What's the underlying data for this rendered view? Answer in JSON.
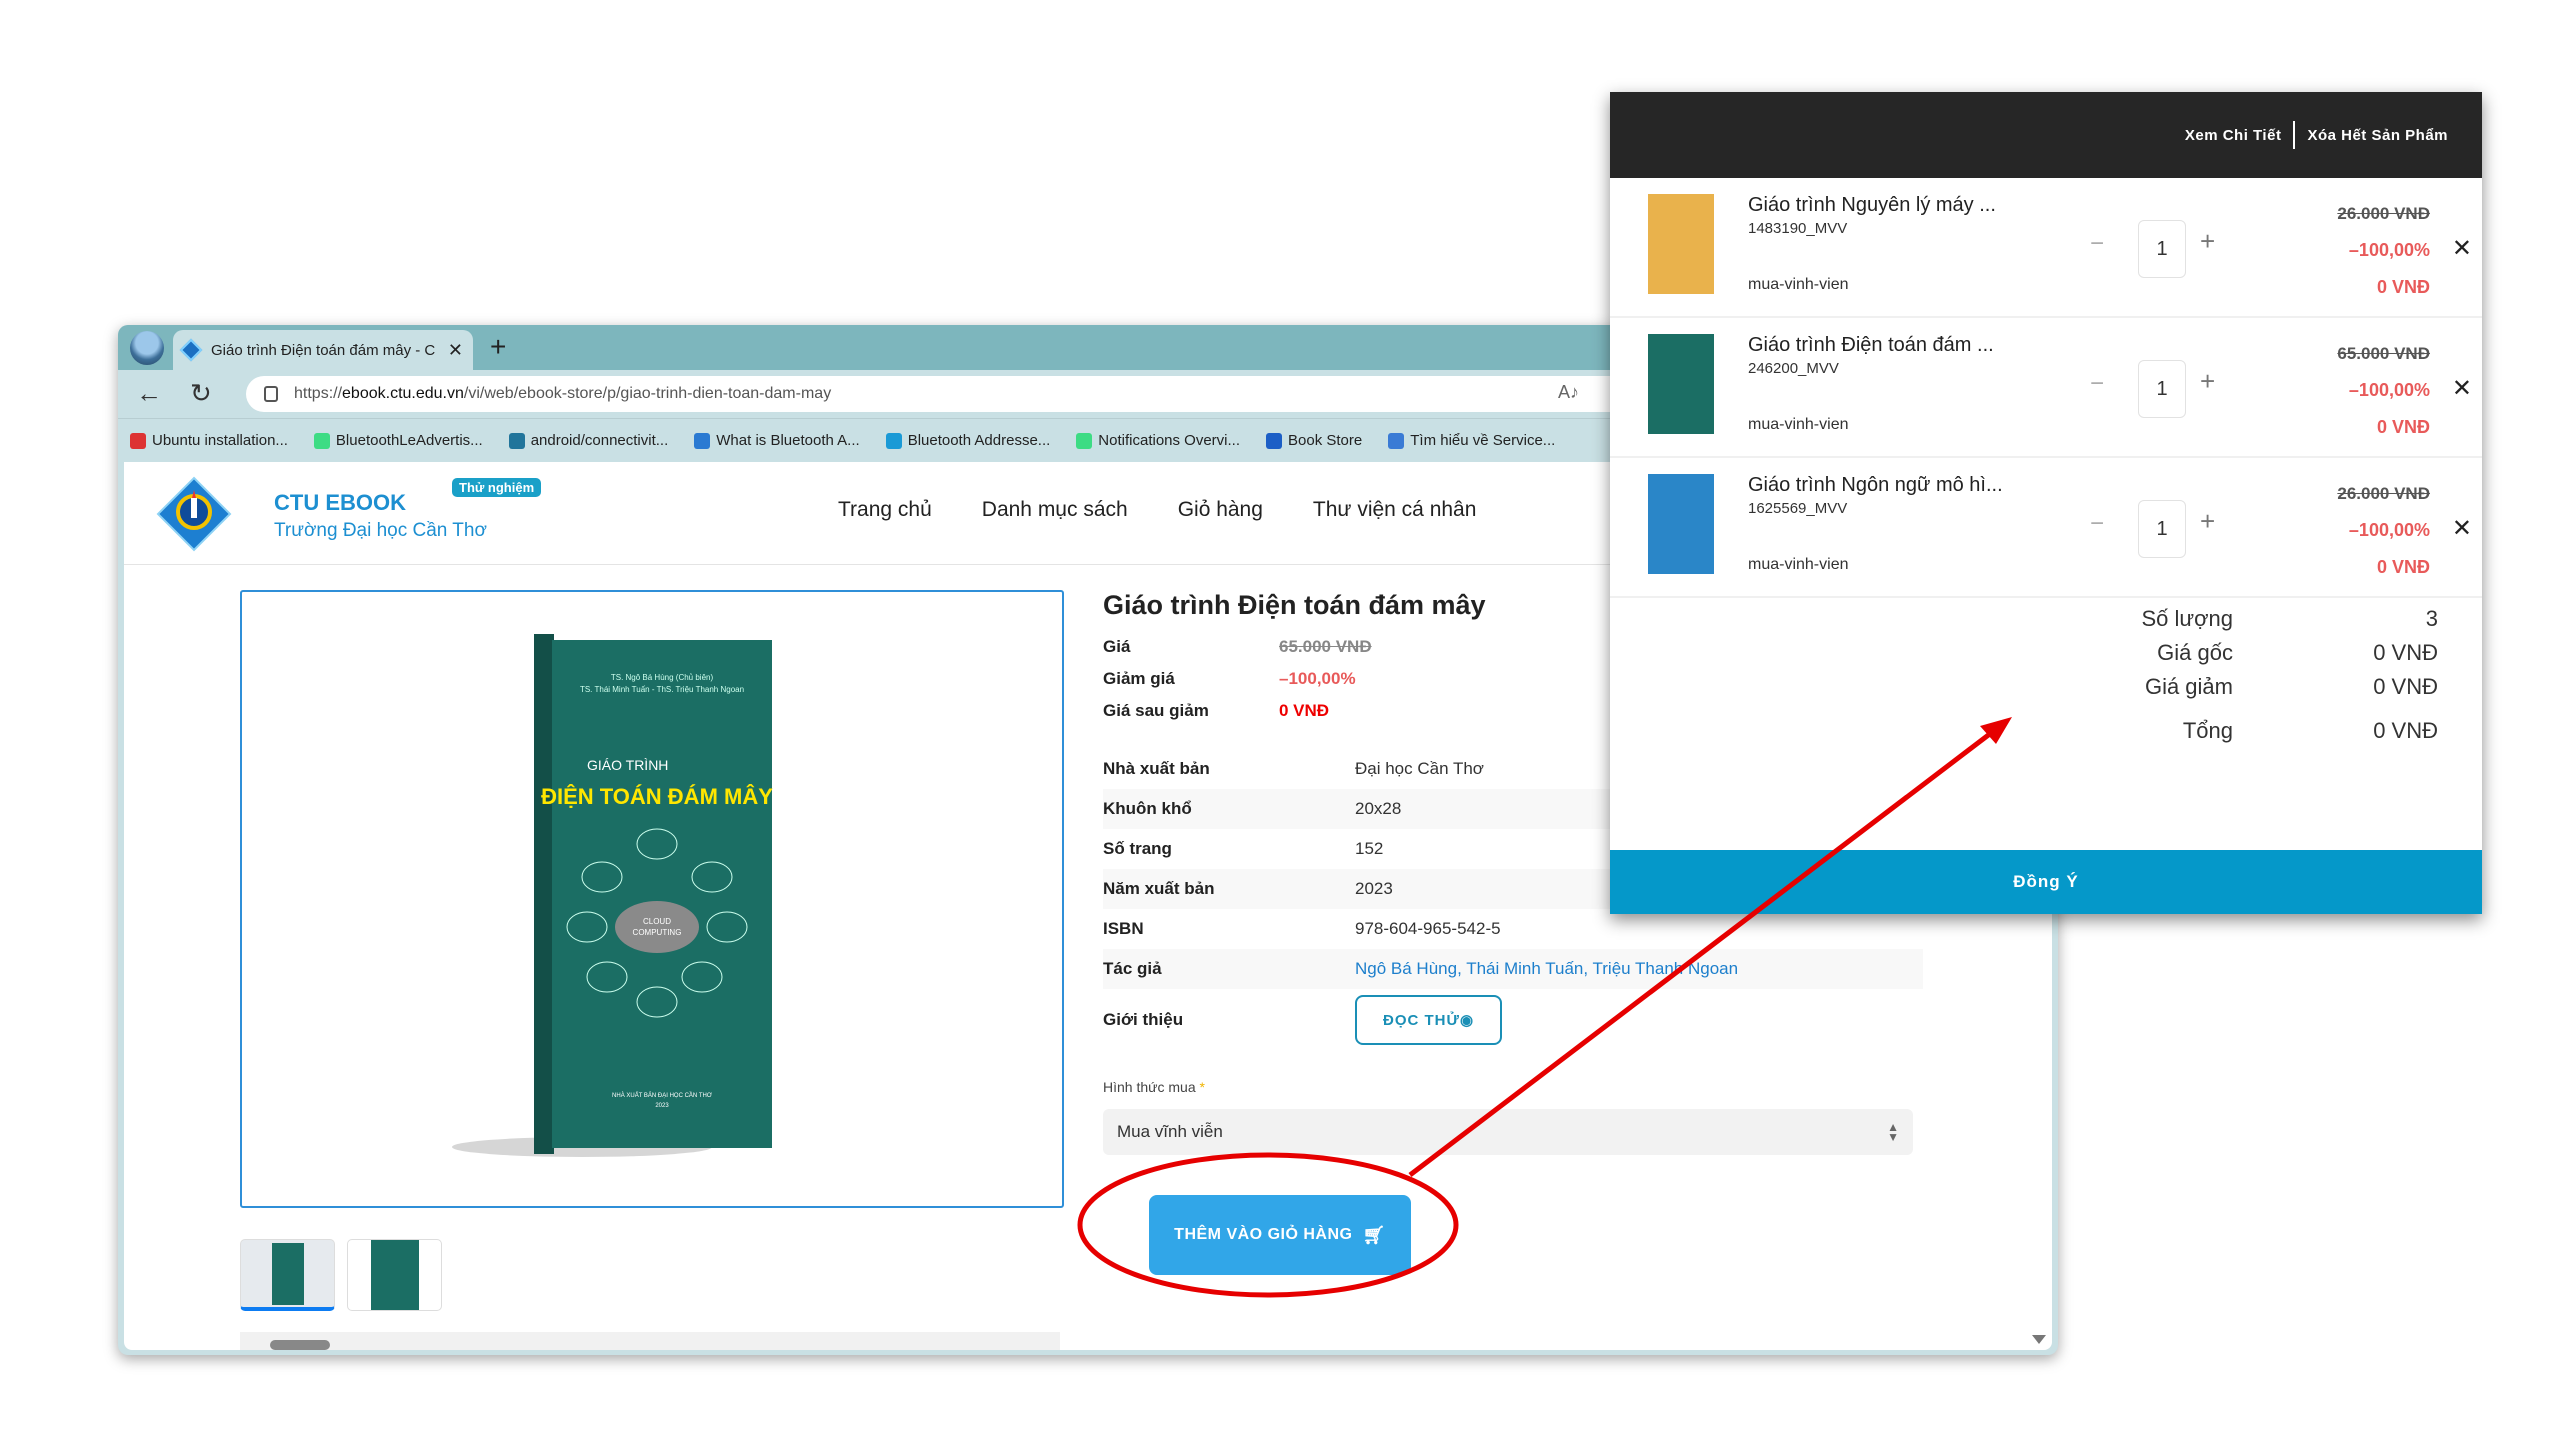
{
  "browser": {
    "tab_title": "Giáo trình Điện toán đám mây - C",
    "new_tab": "+",
    "url_prefix": "https://",
    "url_host": "ebook.ctu.edu.vn",
    "url_path": "/vi/web/ebook-store/p/giao-trinh-dien-toan-dam-may",
    "bookmarks": [
      {
        "label": "Ubuntu installation...",
        "icon": "ubuntu-icon",
        "color": "#d33"
      },
      {
        "label": "BluetoothLeAdvertis...",
        "icon": "android-icon",
        "color": "#3ddc84"
      },
      {
        "label": "android/connectivit...",
        "icon": "wordpress-icon",
        "color": "#21759b"
      },
      {
        "label": "What is Bluetooth A...",
        "icon": "sync-icon",
        "color": "#2a7ad2"
      },
      {
        "label": "Bluetooth Addresse...",
        "icon": "novelbits-icon",
        "color": "#1a9ad6"
      },
      {
        "label": "Notifications Overvi...",
        "icon": "android-icon",
        "color": "#3ddc84"
      },
      {
        "label": "Book Store",
        "icon": "bookstore-icon",
        "color": "#1c5fc6"
      },
      {
        "label": "Tìm hiểu về Service...",
        "icon": "v-icon",
        "color": "#3a7bd5"
      }
    ]
  },
  "site": {
    "brand_name": "CTU EBOOK",
    "brand_sub": "Trường Đại học Cần Thơ",
    "badge": "Thử nghiệm",
    "nav": [
      "Trang chủ",
      "Danh mục sách",
      "Giỏ hàng",
      "Thư viện cá nhân"
    ]
  },
  "product": {
    "title": "Giáo trình Điện toán đám mây",
    "price_label": "Giá",
    "price": "65.000 VNĐ",
    "discount_label": "Giảm giá",
    "discount": "–100,00%",
    "final_label": "Giá sau giảm",
    "final_price": "0 VNĐ",
    "specs": [
      {
        "k": "Nhà xuất bản",
        "v": "Đại học Cần Thơ"
      },
      {
        "k": "Khuôn khổ",
        "v": "20x28"
      },
      {
        "k": "Số trang",
        "v": "152"
      },
      {
        "k": "Năm xuất bản",
        "v": "2023"
      },
      {
        "k": "ISBN",
        "v": "978-604-965-542-5"
      },
      {
        "k": "Tác giả",
        "v": "Ngô Bá Hùng, Thái Minh Tuấn, Triệu Thanh Ngoan"
      }
    ],
    "intro_label": "Giới thiệu",
    "read_button": "ĐỌC THỬ",
    "buy_label": "Hình thức mua",
    "buy_required": "*",
    "buy_option": "Mua vĩnh viễn",
    "add_to_cart": "THÊM VÀO GIỎ HÀNG",
    "cover": {
      "authors_line1": "TS. Ngô Bá Hùng (Chủ biên)",
      "authors_line2": "TS. Thái Minh Tuấn - ThS. Triệu Thanh Ngoan",
      "series": "GIÁO TRÌNH",
      "title": "ĐIỆN TOÁN ĐÁM MÂY",
      "cloud": "CLOUD COMPUTING",
      "publisher": "NHÀ XUẤT BẢN ĐẠI HỌC CẦN THƠ",
      "year": "2023",
      "color": "#1b6e64"
    }
  },
  "cart": {
    "view_details": "Xem Chi Tiết",
    "clear_all": "Xóa Hết Sản Phẩm",
    "items": [
      {
        "name": "Giáo trình Nguyên lý máy ...",
        "sku": "1483190_MVV",
        "mode": "mua-vinh-vien",
        "qty": "1",
        "original": "26.000 VNĐ",
        "discount": "–100,00%",
        "final": "0 VNĐ",
        "cover_color": "#e9b24c"
      },
      {
        "name": "Giáo trình Điện toán đám ...",
        "sku": "246200_MVV",
        "mode": "mua-vinh-vien",
        "qty": "1",
        "original": "65.000 VNĐ",
        "discount": "–100,00%",
        "final": "0 VNĐ",
        "cover_color": "#1b6e64"
      },
      {
        "name": "Giáo trình Ngôn ngữ mô hì...",
        "sku": "1625569_MVV",
        "mode": "mua-vinh-vien",
        "qty": "1",
        "original": "26.000 VNĐ",
        "discount": "–100,00%",
        "final": "0 VNĐ",
        "cover_color": "#2a86c8"
      }
    ],
    "summary": [
      {
        "k": "Số lượng",
        "v": "3"
      },
      {
        "k": "Giá gốc",
        "v": "0 VNĐ"
      },
      {
        "k": "Giá giảm",
        "v": "0 VNĐ"
      },
      {
        "k": "Tổng",
        "v": "0 VNĐ"
      }
    ],
    "ok_button": "Đồng Ý"
  },
  "colors": {
    "accent": "#31a6e8",
    "cart_header": "#262626",
    "ok_button": "#0598c9",
    "discount_red": "#e85a5a",
    "annotation_red": "#e60000"
  }
}
